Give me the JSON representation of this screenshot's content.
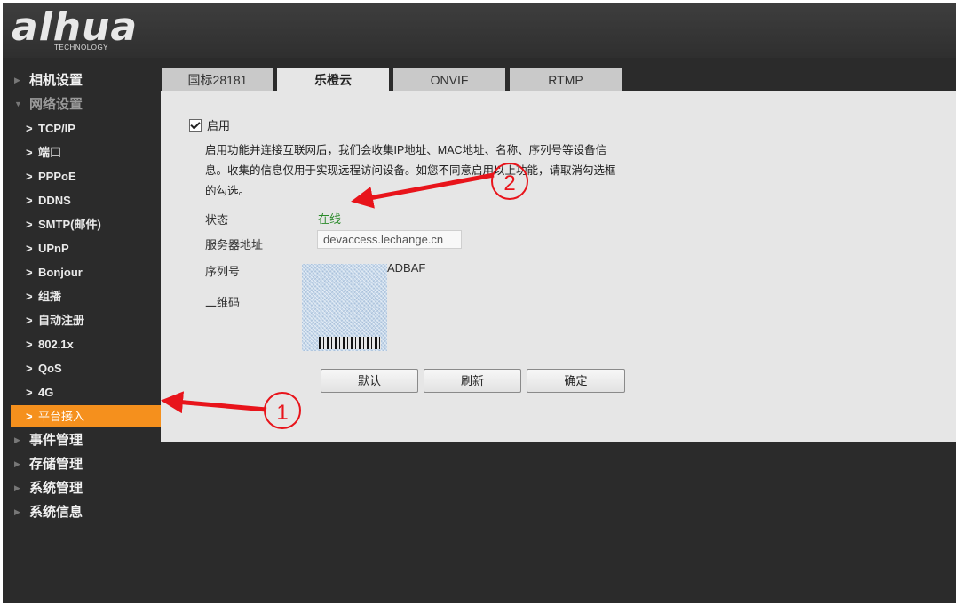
{
  "brand": {
    "logo_text": "alhua",
    "logo_sub": "TECHNOLOGY"
  },
  "sidebar": {
    "categories_top": [
      {
        "label": "相机设置"
      },
      {
        "label": "网络设置"
      }
    ],
    "items": [
      {
        "label": "TCP/IP"
      },
      {
        "label": "端口"
      },
      {
        "label": "PPPoE"
      },
      {
        "label": "DDNS"
      },
      {
        "label": "SMTP(邮件)"
      },
      {
        "label": "UPnP"
      },
      {
        "label": "Bonjour"
      },
      {
        "label": "组播"
      },
      {
        "label": "自动注册"
      },
      {
        "label": "802.1x"
      },
      {
        "label": "QoS"
      },
      {
        "label": "4G"
      },
      {
        "label": "平台接入"
      }
    ],
    "categories_bottom": [
      {
        "label": "事件管理"
      },
      {
        "label": "存储管理"
      },
      {
        "label": "系统管理"
      },
      {
        "label": "系统信息"
      }
    ]
  },
  "tabs": [
    {
      "label": "国标28181"
    },
    {
      "label": "乐橙云"
    },
    {
      "label": "ONVIF"
    },
    {
      "label": "RTMP"
    }
  ],
  "form": {
    "enable_label": "启用",
    "enabled": true,
    "notice_line1": "启用功能并连接互联网后，我们会收集IP地址、MAC地址、名称、序列号等设备信",
    "notice_line2": "息。收集的信息仅用于实现远程访问设备。如您不同意启用以上功能，请取消勾选框",
    "notice_line3": "的勾选。",
    "status_label": "状态",
    "status_value": "在线",
    "server_label": "服务器地址",
    "server_value": "devaccess.lechange.cn",
    "serial_label": "序列号",
    "serial_visible": "ADBAF",
    "qrcode_label": "二维码"
  },
  "buttons": {
    "default": "默认",
    "refresh": "刷新",
    "confirm": "确定"
  },
  "annotations": {
    "marker1": "1",
    "marker2": "2",
    "arrow_color": "#e8141b"
  },
  "colors": {
    "accent": "#f5901d",
    "status_online": "#2a8a2a",
    "background": "#2b2b2b",
    "panel": "#e6e6e6"
  }
}
